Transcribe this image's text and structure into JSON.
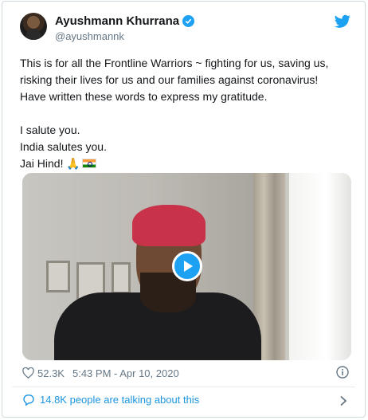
{
  "author": {
    "display_name": "Ayushmann Khurrana",
    "handle": "@ayushmannk",
    "verified": true
  },
  "tweet": {
    "lines": [
      "This is for all the Frontline Warriors ~ fighting for us, saving us,",
      "risking their lives for us and our families against coronavirus!",
      "Have written these words to express my gratitude."
    ],
    "line_salute": "I salute you.",
    "line_india": "India salutes you.",
    "line_jaihind": "Jai Hind! 🙏"
  },
  "media": {
    "type": "video",
    "play_icon": "play-icon"
  },
  "stats": {
    "likes": "52.3K",
    "timestamp": "5:43 PM - Apr 10, 2020"
  },
  "footer": {
    "talking_text": "14.8K people are talking about this"
  },
  "colors": {
    "accent": "#1da1f2",
    "link": "#1b95e0",
    "muted": "#657786"
  }
}
